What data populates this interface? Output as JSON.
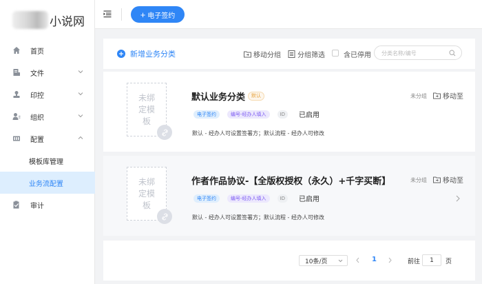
{
  "sidebar": {
    "logo_text": "小说网",
    "items": [
      {
        "label": "首页",
        "icon": "home-icon"
      },
      {
        "label": "文件",
        "icon": "file-icon",
        "expandable": true
      },
      {
        "label": "印控",
        "icon": "stamp-icon",
        "expandable": true
      },
      {
        "label": "组织",
        "icon": "organization-icon",
        "expandable": true
      },
      {
        "label": "配置",
        "icon": "config-icon",
        "expanded": true
      },
      {
        "label": "审计",
        "icon": "audit-icon"
      }
    ],
    "sub_items": [
      {
        "label": "模板库管理"
      },
      {
        "label": "业务流配置",
        "active": true
      }
    ]
  },
  "topbar": {
    "esign_button": "电子签约"
  },
  "toolbar": {
    "add_category": "新增业务分类",
    "move_group": "移动分组",
    "filter_group": "分组筛选",
    "include_disabled": "含已停用",
    "search_placeholder": "分类名称/编号"
  },
  "cards": [
    {
      "template_placeholder": "未绑定模板",
      "title": "默认业务分类",
      "default_tag": "默认",
      "tag_esign": "电子签约",
      "tag_number": "编号-经办人填入",
      "tag_id": "ID",
      "status": "已启用",
      "description": "默认 - 经办人可设置签署方；默认流程 - 经办人可修改",
      "group": "未分组",
      "move_to": "移动至"
    },
    {
      "template_placeholder": "未绑定模板",
      "title": "作者作品协议-【全版权授权（永久）+千字买断】",
      "tag_esign": "电子签约",
      "tag_number": "编号-经办人填入",
      "tag_id": "ID",
      "status": "已启用",
      "description": "默认 - 经办人可设置签署方；默认流程 - 经办人可修改",
      "group": "未分组",
      "move_to": "移动至"
    }
  ],
  "pagination": {
    "page_size": "10条/页",
    "current_page": "1",
    "goto_prefix": "前往",
    "goto_value": "1",
    "goto_suffix": "页"
  },
  "colors": {
    "primary": "#2f86f6",
    "active_bg": "#ddeefe",
    "default_tag": "#e6a23c",
    "purple_tag": "#7d5cf2"
  }
}
